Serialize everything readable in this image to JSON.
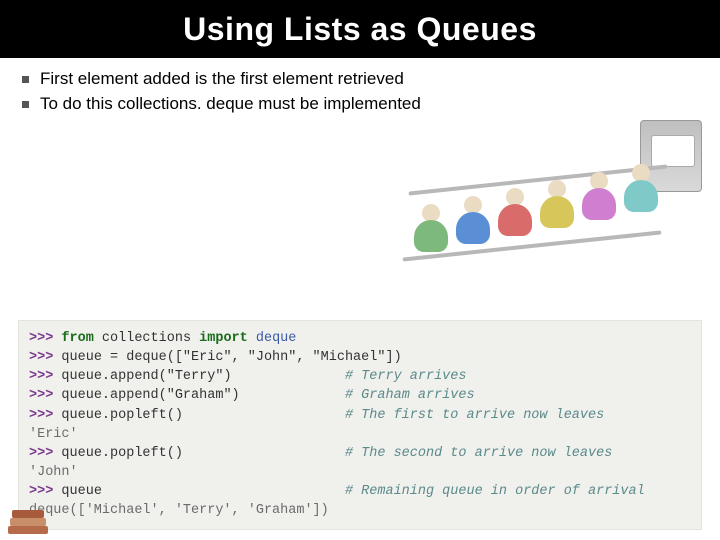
{
  "title": "Using Lists as Queues",
  "bullets": [
    "First element added is the first element retrieved",
    "To do this collections. deque must be implemented"
  ],
  "code": {
    "lines": [
      {
        "prompt": ">>>",
        "segs": [
          {
            "t": " ",
            "c": ""
          },
          {
            "t": "from",
            "c": "kw"
          },
          {
            "t": " collections ",
            "c": ""
          },
          {
            "t": "import",
            "c": "kw"
          },
          {
            "t": " deque",
            "c": "mod"
          }
        ]
      },
      {
        "prompt": ">>>",
        "segs": [
          {
            "t": " queue = deque([\"Eric\", \"John\", \"Michael\"])",
            "c": ""
          }
        ]
      },
      {
        "prompt": ">>>",
        "segs": [
          {
            "t": " queue.append(\"Terry\")",
            "c": ""
          }
        ],
        "pad": 14,
        "comment": "# Terry arrives"
      },
      {
        "prompt": ">>>",
        "segs": [
          {
            "t": " queue.append(\"Graham\")",
            "c": ""
          }
        ],
        "pad": 13,
        "comment": "# Graham arrives"
      },
      {
        "prompt": ">>>",
        "segs": [
          {
            "t": " queue.popleft()",
            "c": ""
          }
        ],
        "pad": 20,
        "comment": "# The first to arrive now leaves"
      },
      {
        "output": "'Eric'"
      },
      {
        "prompt": ">>>",
        "segs": [
          {
            "t": " queue.popleft()",
            "c": ""
          }
        ],
        "pad": 20,
        "comment": "# The second to arrive now leaves"
      },
      {
        "output": "'John'"
      },
      {
        "prompt": ">>>",
        "segs": [
          {
            "t": " queue",
            "c": ""
          }
        ],
        "pad": 30,
        "comment": "# Remaining queue in order of arrival"
      },
      {
        "output": "deque(['Michael', 'Terry', 'Graham'])"
      }
    ]
  }
}
